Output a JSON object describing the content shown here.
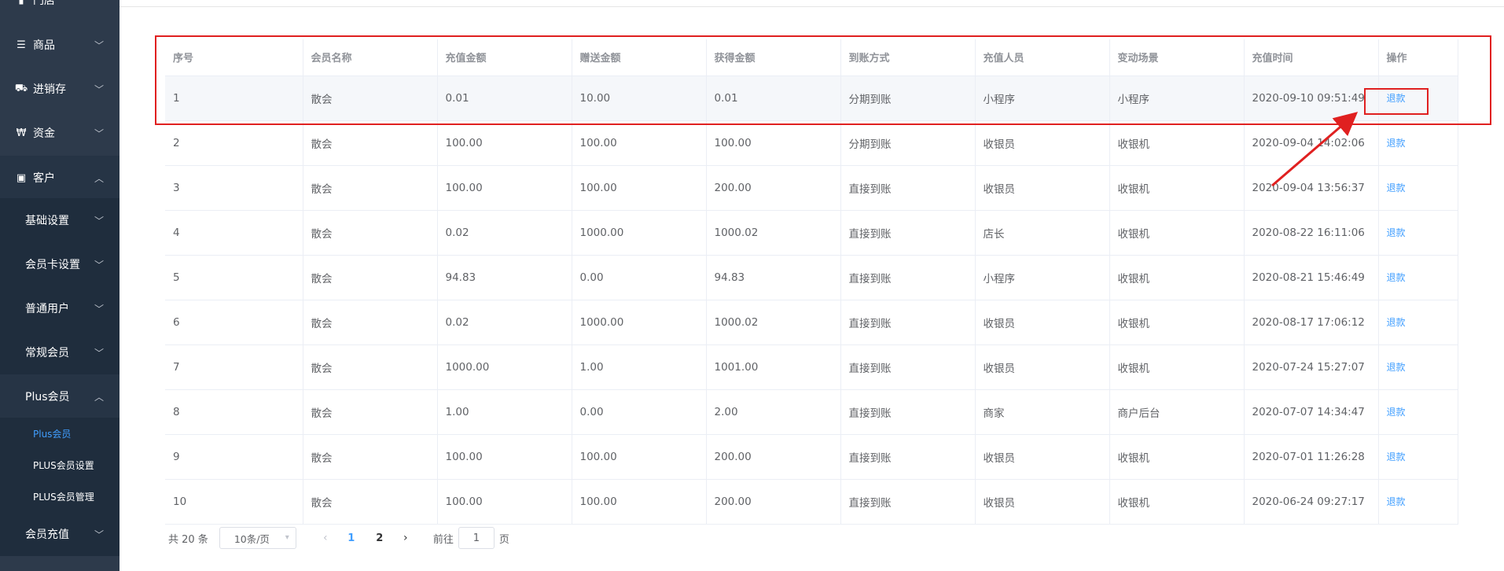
{
  "sidebar": {
    "menus": [
      {
        "label": "门店",
        "icon": "store-icon"
      },
      {
        "label": "商品",
        "icon": "list-icon"
      },
      {
        "label": "进销存",
        "icon": "truck-icon"
      },
      {
        "label": "资金",
        "icon": "currency-icon"
      },
      {
        "label": "客户",
        "icon": "id-card-icon"
      }
    ],
    "submenus": [
      {
        "label": "基础设置"
      },
      {
        "label": "会员卡设置"
      },
      {
        "label": "普通用户"
      },
      {
        "label": "常规会员"
      },
      {
        "label": "Plus会员"
      }
    ],
    "leaves": [
      {
        "label": "Plus会员"
      },
      {
        "label": "PLUS会员设置"
      },
      {
        "label": "PLUS会员管理"
      }
    ],
    "last": {
      "label": "会员充值"
    }
  },
  "table": {
    "headers": [
      "序号",
      "会员名称",
      "充值金额",
      "赠送金额",
      "获得金额",
      "到账方式",
      "充值人员",
      "变动场景",
      "充值时间",
      "操作"
    ],
    "action_label": "退款",
    "rows": [
      [
        "1",
        "散会",
        "0.01",
        "10.00",
        "0.01",
        "分期到账",
        "小程序",
        "小程序",
        "2020-09-10 09:51:49"
      ],
      [
        "2",
        "散会",
        "100.00",
        "100.00",
        "100.00",
        "分期到账",
        "收银员",
        "收银机",
        "2020-09-04 14:02:06"
      ],
      [
        "3",
        "散会",
        "100.00",
        "100.00",
        "200.00",
        "直接到账",
        "收银员",
        "收银机",
        "2020-09-04 13:56:37"
      ],
      [
        "4",
        "散会",
        "0.02",
        "1000.00",
        "1000.02",
        "直接到账",
        "店长",
        "收银机",
        "2020-08-22 16:11:06"
      ],
      [
        "5",
        "散会",
        "94.83",
        "0.00",
        "94.83",
        "直接到账",
        "小程序",
        "收银机",
        "2020-08-21 15:46:49"
      ],
      [
        "6",
        "散会",
        "0.02",
        "1000.00",
        "1000.02",
        "直接到账",
        "收银员",
        "收银机",
        "2020-08-17 17:06:12"
      ],
      [
        "7",
        "散会",
        "1000.00",
        "1.00",
        "1001.00",
        "直接到账",
        "收银员",
        "收银机",
        "2020-07-24 15:27:07"
      ],
      [
        "8",
        "散会",
        "1.00",
        "0.00",
        "2.00",
        "直接到账",
        "商家",
        "商户后台",
        "2020-07-07 14:34:47"
      ],
      [
        "9",
        "散会",
        "100.00",
        "100.00",
        "200.00",
        "直接到账",
        "收银员",
        "收银机",
        "2020-07-01 11:26:28"
      ],
      [
        "10",
        "散会",
        "100.00",
        "100.00",
        "200.00",
        "直接到账",
        "收银员",
        "收银机",
        "2020-06-24 09:27:17"
      ]
    ]
  },
  "pagination": {
    "total": "共 20 条",
    "page_size": "10条/页",
    "pages": [
      "1",
      "2"
    ],
    "current": "1",
    "goto_prefix": "前往",
    "goto_value": "1",
    "goto_suffix": "页"
  },
  "colors": {
    "sidebar": "#2d3a4b",
    "accent": "#409eff",
    "annotation": "#e02020"
  }
}
